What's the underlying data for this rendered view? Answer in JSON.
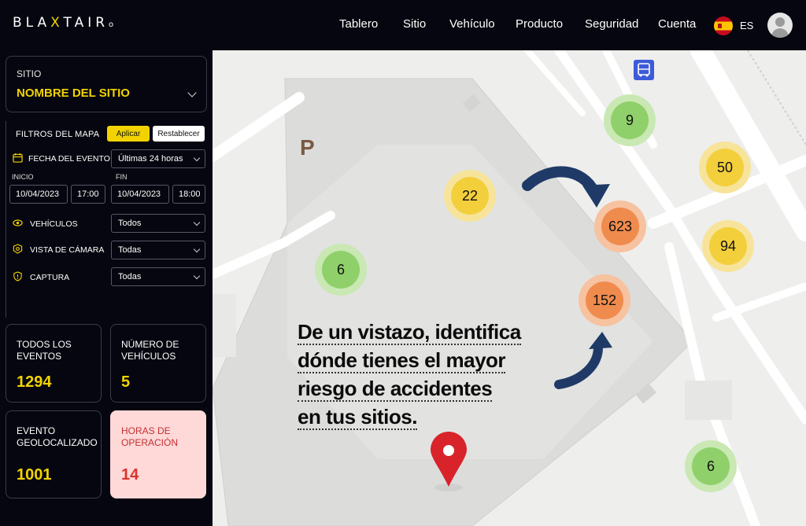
{
  "header": {
    "logo": {
      "l1": "BLA",
      "x": "X",
      "l2": "TAIR",
      "tail": "o"
    },
    "nav": [
      "Tablero",
      "Sitio",
      "Vehículo",
      "Producto",
      "Seguridad",
      "Cuenta"
    ],
    "lang": "ES",
    "flag_icon": "spain-flag-icon",
    "avatar_icon": "user-avatar-icon"
  },
  "sidebar": {
    "site": {
      "label": "SITIO",
      "name": "NOMBRE DEL SITIO"
    },
    "filters": {
      "title": "FILTROS DEL MAPA",
      "apply": "Aplicar",
      "reset": "Restablecer",
      "event_date": {
        "label": "FECHA DEL EVENTO",
        "value": "Últimas 24 horas"
      },
      "start": {
        "label": "INICIO",
        "date": "10/04/2023",
        "time": "17:00"
      },
      "end": {
        "label": "FIN",
        "date": "10/04/2023",
        "time": "18:00"
      },
      "vehicles": {
        "label": "VEHÍCULOS",
        "value": "Todos"
      },
      "camera_view": {
        "label": "VISTA DE CÁMARA",
        "value": "Todas"
      },
      "capture": {
        "label": "CAPTURA",
        "value": "Todas"
      }
    },
    "stats": [
      {
        "label": "TODOS LOS EVENTOS",
        "value": "1294"
      },
      {
        "label": "NÚMERO DE VEHÍCULOS",
        "value": "5"
      },
      {
        "label": "EVENTO GEOLOCALIZADO",
        "value": "1001"
      },
      {
        "label": "HORAS DE OPERACIÓN",
        "value": "14"
      }
    ]
  },
  "map": {
    "parking_label": "P",
    "headline": [
      "De un vistazo, identifica",
      "dónde tienes el mayor",
      "riesgo de accidentes",
      "en tus sitios."
    ],
    "clusters": [
      {
        "count": "9",
        "level": "low"
      },
      {
        "count": "50",
        "level": "medium"
      },
      {
        "count": "22",
        "level": "medium"
      },
      {
        "count": "623",
        "level": "high"
      },
      {
        "count": "94",
        "level": "medium"
      },
      {
        "count": "6",
        "level": "low"
      },
      {
        "count": "152",
        "level": "high"
      },
      {
        "count": "6",
        "level": "low"
      }
    ],
    "colors": {
      "low": "#8fd06a",
      "medium": "#f3cf3c",
      "high": "#f08b4e"
    }
  }
}
